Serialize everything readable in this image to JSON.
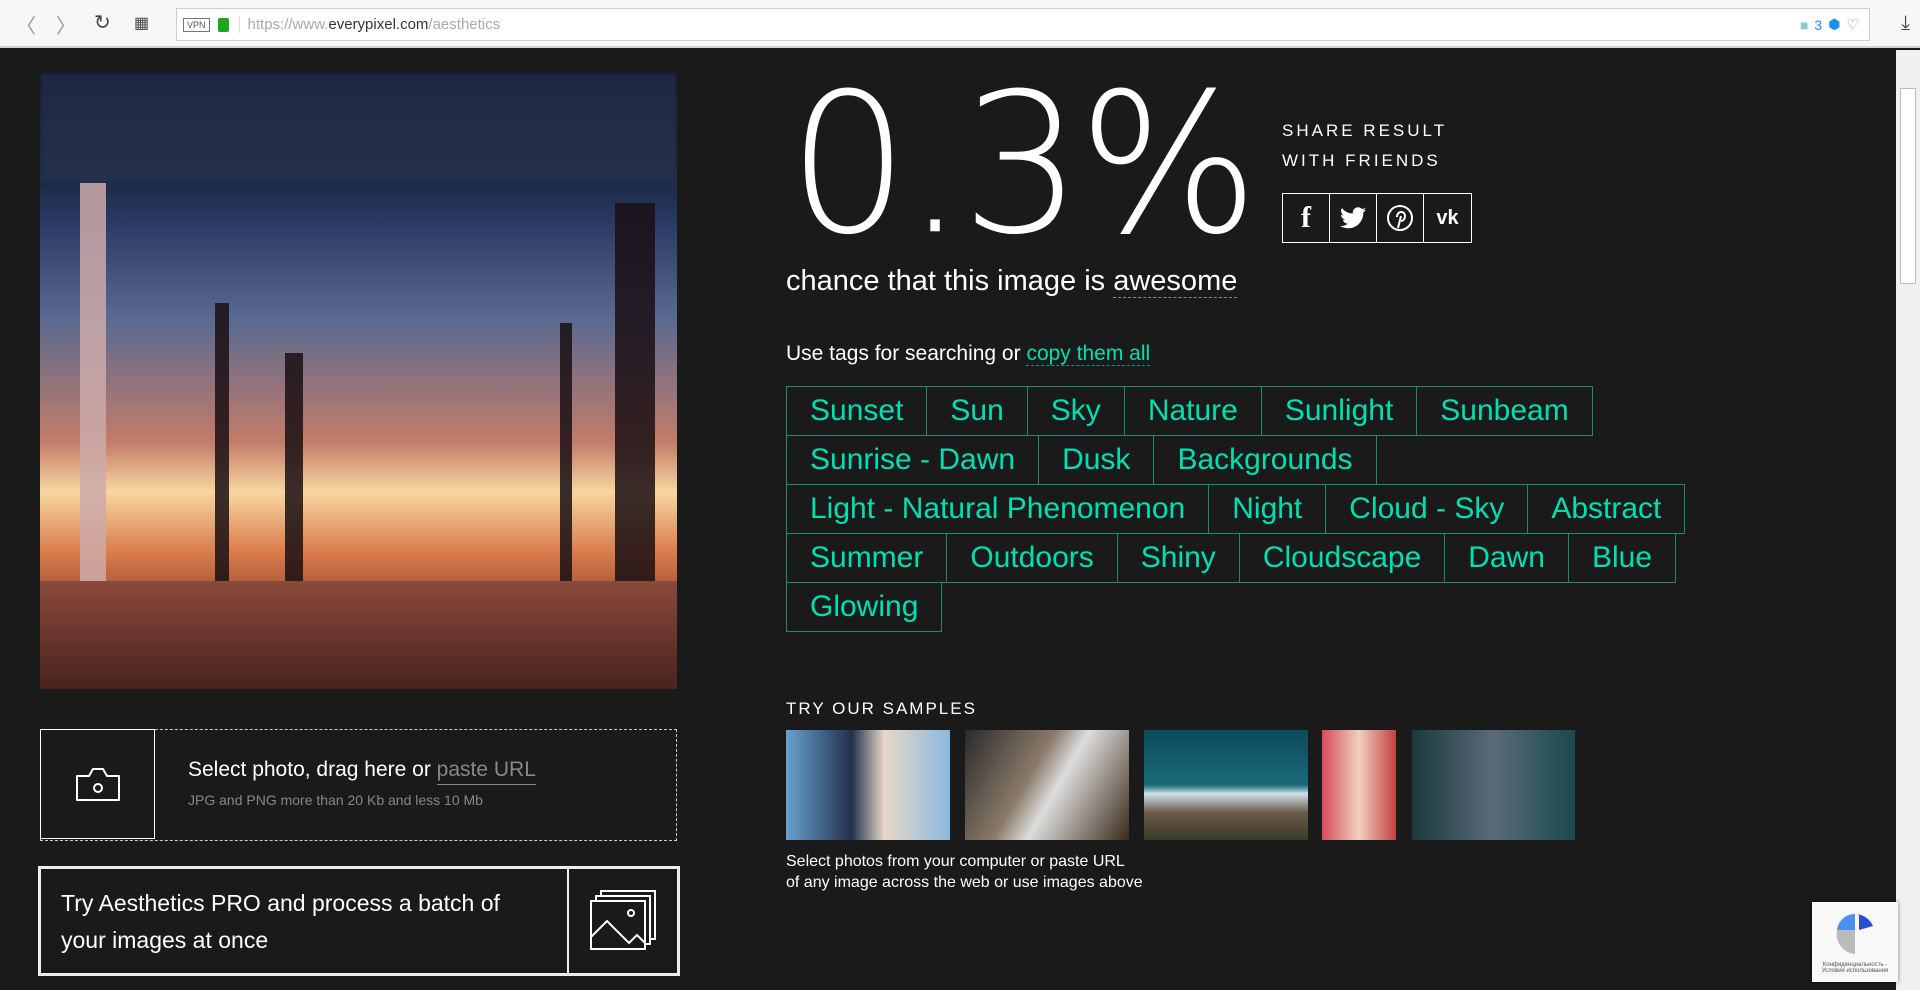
{
  "browser": {
    "url_prefix": "https://www.",
    "url_domain": "everypixel.com",
    "url_path": "/aesthetics",
    "vpn": "VPN",
    "ext_count": "3"
  },
  "upload": {
    "main": "Select photo, drag here or ",
    "link": "paste URL",
    "hint": "JPG and PNG more than 20 Kb and less 10 Mb"
  },
  "pro": {
    "text": "Try Aesthetics PRO and process a batch of your images at once"
  },
  "result": {
    "score": "0.3%",
    "chance_prefix": "chance that this image is ",
    "chance_word": "awesome"
  },
  "share": {
    "line1": "SHARE RESULT",
    "line2": "WITH FRIENDS",
    "networks": [
      "f",
      "tw",
      "p",
      "vk"
    ]
  },
  "tags": {
    "intro": "Use tags for searching or ",
    "copy": "copy them all",
    "rows": [
      [
        "Sunset",
        "Sun",
        "Sky",
        "Nature",
        "Sunlight",
        "Sunbeam"
      ],
      [
        "Sunrise - Dawn",
        "Dusk",
        "Backgrounds"
      ],
      [
        "Light - Natural Phenomenon",
        "Night",
        "Cloud - Sky",
        "Abstract"
      ],
      [
        "Summer",
        "Outdoors",
        "Shiny",
        "Cloudscape",
        "Dawn",
        "Blue"
      ],
      [
        "Glowing"
      ]
    ]
  },
  "samples": {
    "title": "TRY OUR SAMPLES",
    "caption1": "Select photos from your computer or paste URL",
    "caption2": "of any image across the web or use images above"
  },
  "recaptcha": {
    "text": "Конфиденциальность - Условия использования"
  },
  "colors": {
    "bg": "#1a1a1a",
    "accent": "#00e0b0",
    "tag_border": "#1d8a76"
  }
}
